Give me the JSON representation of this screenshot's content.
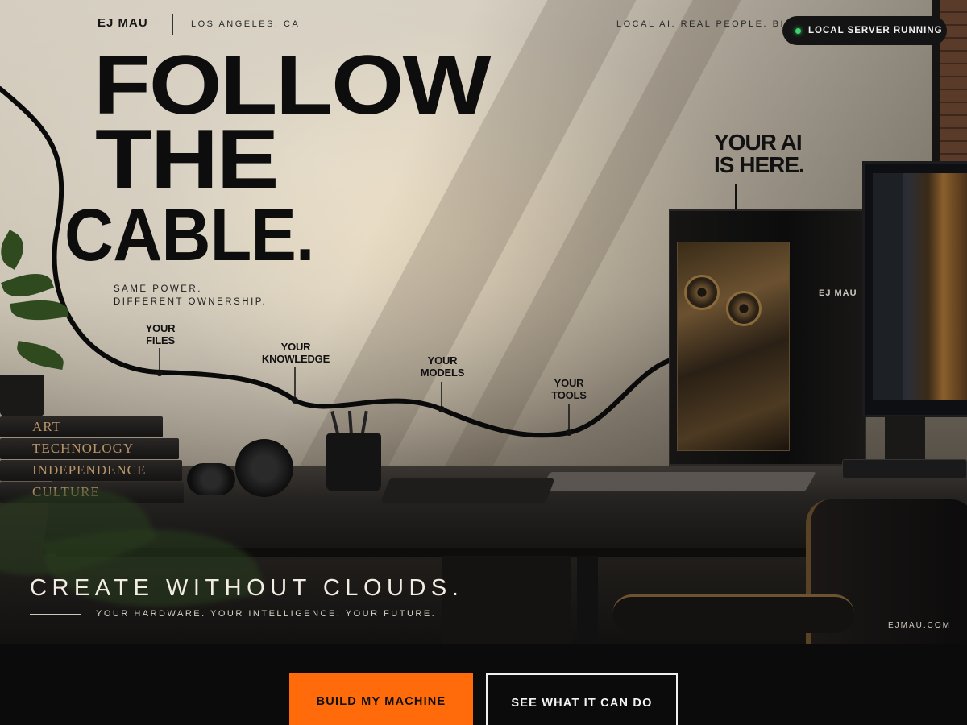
{
  "header": {
    "brand": "EJ MAU",
    "location": "LOS ANGELES, CA",
    "tagline": "LOCAL AI. REAL PEOPLE. BIG",
    "status": "LOCAL SERVER RUNNING",
    "status_color": "#3bd36b"
  },
  "headline": {
    "line1": "FOLLOW",
    "line2": "THE",
    "line3": "CABLE.",
    "sub_line1": "SAME POWER.",
    "sub_line2": "DIFFERENT OWNERSHIP."
  },
  "cable_labels": {
    "files_1": "YOUR",
    "files_2": "FILES",
    "knowledge_1": "YOUR",
    "knowledge_2": "KNOWLEDGE",
    "models_1": "YOUR",
    "models_2": "MODELS",
    "tools_1": "YOUR",
    "tools_2": "TOOLS"
  },
  "callout": {
    "line1": "YOUR AI",
    "line2": "IS HERE."
  },
  "pc_logo": "EJ MAU",
  "books": [
    "ART",
    "TECHNOLOGY",
    "INDEPENDENCE",
    "CULTURE"
  ],
  "footer": {
    "create": "CREATE WITHOUT CLOUDS.",
    "create_sub": "YOUR HARDWARE. YOUR INTELLIGENCE. YOUR FUTURE.",
    "site": "EJMAU.COM"
  },
  "cta": {
    "primary": "BUILD MY MACHINE",
    "secondary": "SEE WHAT IT CAN DO",
    "primary_color": "#ff6b0a"
  }
}
